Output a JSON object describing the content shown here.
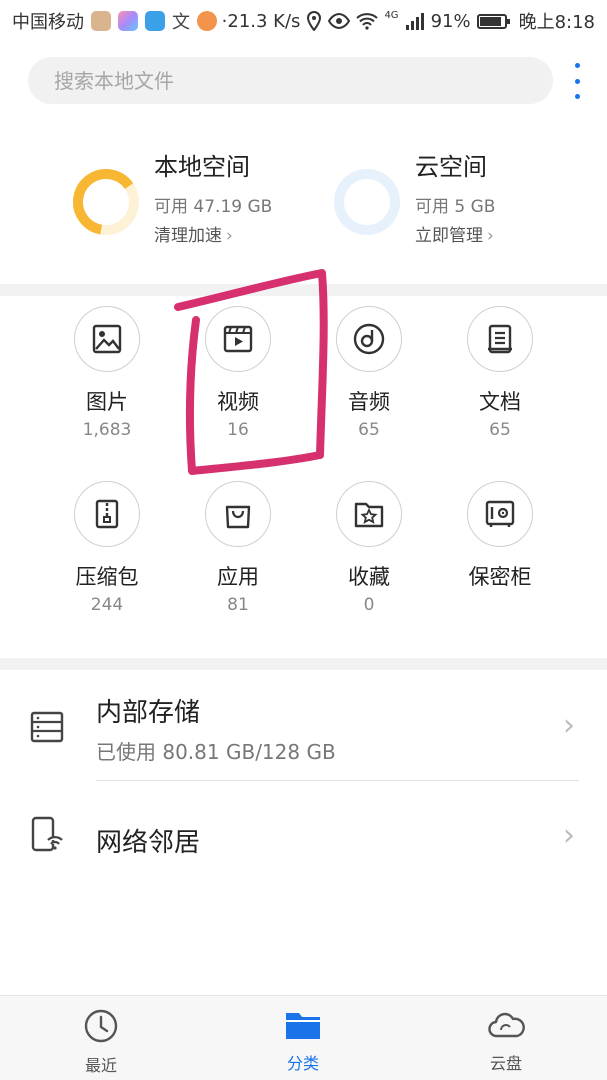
{
  "status_bar": {
    "carrier": "中国移动",
    "speed": "·21.3 K/s",
    "network": "4G",
    "battery": "91%",
    "battery_level": 0.91,
    "time": "晚上8:18"
  },
  "search": {
    "placeholder": "搜索本地文件"
  },
  "storage": {
    "local": {
      "title": "本地空间",
      "free": "可用 47.19 GB",
      "action": "清理加速",
      "ring_color": "#f7b733",
      "ring_track": "#fdf1d6"
    },
    "cloud": {
      "title": "云空间",
      "free": "可用 5 GB",
      "action": "立即管理",
      "ring_color": "#dcecfb",
      "ring_track": "#e8f2fc"
    }
  },
  "categories": [
    {
      "label": "图片",
      "count": "1,683",
      "icon": "image-icon"
    },
    {
      "label": "视频",
      "count": "16",
      "icon": "video-icon"
    },
    {
      "label": "音频",
      "count": "65",
      "icon": "music-disc-icon"
    },
    {
      "label": "文档",
      "count": "65",
      "icon": "document-icon"
    },
    {
      "label": "压缩包",
      "count": "244",
      "icon": "zip-icon"
    },
    {
      "label": "应用",
      "count": "81",
      "icon": "shopping-bag-icon"
    },
    {
      "label": "收藏",
      "count": "0",
      "icon": "star-folder-icon"
    },
    {
      "label": "保密柜",
      "count": "",
      "icon": "safe-icon"
    }
  ],
  "drives": {
    "internal": {
      "title": "内部存储",
      "sub": "已使用 80.81 GB/128 GB"
    },
    "network": {
      "title": "网络邻居"
    }
  },
  "bottom_nav": [
    {
      "label": "最近",
      "icon": "clock-icon"
    },
    {
      "label": "分类",
      "icon": "folder-icon",
      "active": true
    },
    {
      "label": "云盘",
      "icon": "cloud-icon"
    }
  ],
  "colors": {
    "accent": "#1a73e8",
    "annotation": "#d6306f"
  }
}
